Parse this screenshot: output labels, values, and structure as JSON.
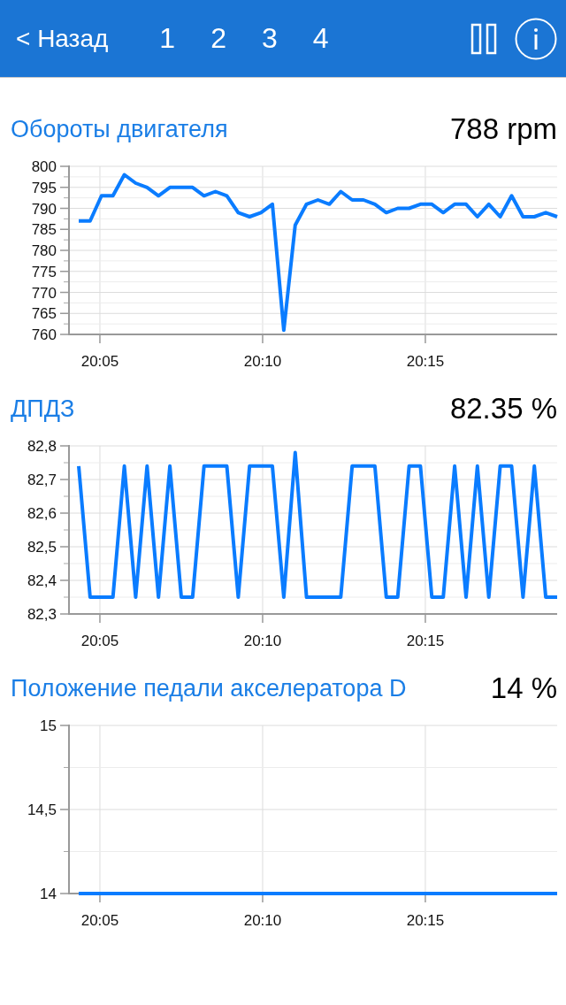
{
  "nav_bar": {
    "back": "< Назад",
    "tabs": [
      {
        "label": "1"
      },
      {
        "label": "2"
      },
      {
        "label": "3"
      },
      {
        "label": "4"
      }
    ]
  },
  "sections": [
    {
      "title": "Обороты двигателя",
      "value": "788 rpm",
      "chart_data": {
        "type": "line",
        "x": [
          1204.35,
          1204.7,
          1205.05,
          1205.4,
          1205.75,
          1206.1,
          1206.45,
          1206.8,
          1207.15,
          1207.5,
          1207.85,
          1208.2,
          1208.55,
          1208.9,
          1209.25,
          1209.6,
          1209.95,
          1210.3,
          1210.65,
          1211.0,
          1211.35,
          1211.7,
          1212.05,
          1212.4,
          1212.75,
          1213.1,
          1213.45,
          1213.8,
          1214.15,
          1214.5,
          1214.85,
          1215.2,
          1215.55,
          1215.9,
          1216.25,
          1216.6,
          1216.95,
          1217.3,
          1217.65,
          1218.0,
          1218.35,
          1218.7,
          1219.05
        ],
        "series": [
          {
            "color": "#0a7cff",
            "values": [
              787,
              787,
              793,
              793,
              798,
              796,
              795,
              793,
              795,
              795,
              795,
              793,
              794,
              793,
              789,
              788,
              789,
              791,
              761,
              786,
              791,
              792,
              791,
              794,
              792,
              792,
              791,
              789,
              790,
              790,
              791,
              791,
              789,
              791,
              791,
              788,
              791,
              788,
              793,
              788,
              788,
              789,
              788
            ]
          }
        ],
        "xlim": [
          1204.05,
          1219.05
        ],
        "ylim": [
          760,
          800
        ],
        "xticks": [
          {
            "value": 1205,
            "label": "20:05"
          },
          {
            "value": 1210,
            "label": "20:10"
          },
          {
            "value": 1215,
            "label": "20:15"
          }
        ],
        "yticks": [
          760,
          765,
          770,
          775,
          780,
          785,
          790,
          795,
          800
        ],
        "ref_lines": [
          {
            "axis": "y",
            "value": 762.5
          },
          {
            "axis": "y",
            "value": 767.5
          },
          {
            "axis": "y",
            "value": 772.5
          },
          {
            "axis": "y",
            "value": 777.5
          },
          {
            "axis": "y",
            "value": 782.5
          },
          {
            "axis": "y",
            "value": 787.5
          },
          {
            "axis": "y",
            "value": 792.5
          },
          {
            "axis": "y",
            "value": 797.5
          }
        ],
        "grid": true
      }
    },
    {
      "title": "ДПДЗ",
      "value": "82.35 %",
      "chart_data": {
        "type": "line",
        "x": [
          1204.35,
          1204.7,
          1205.05,
          1205.4,
          1205.75,
          1206.1,
          1206.45,
          1206.8,
          1207.15,
          1207.5,
          1207.85,
          1208.2,
          1208.55,
          1208.9,
          1209.25,
          1209.6,
          1209.95,
          1210.3,
          1210.65,
          1211.0,
          1211.35,
          1211.7,
          1212.05,
          1212.4,
          1212.75,
          1213.1,
          1213.45,
          1213.8,
          1214.15,
          1214.5,
          1214.85,
          1215.2,
          1215.55,
          1215.9,
          1216.25,
          1216.6,
          1216.95,
          1217.3,
          1217.65,
          1218.0,
          1218.35,
          1218.7,
          1219.05
        ],
        "series": [
          {
            "color": "#0a7cff",
            "values": [
              82.74,
              82.35,
              82.35,
              82.35,
              82.74,
              82.35,
              82.74,
              82.35,
              82.74,
              82.35,
              82.35,
              82.74,
              82.74,
              82.74,
              82.35,
              82.74,
              82.74,
              82.74,
              82.35,
              82.78,
              82.35,
              82.35,
              82.35,
              82.35,
              82.74,
              82.74,
              82.74,
              82.35,
              82.35,
              82.74,
              82.74,
              82.35,
              82.35,
              82.74,
              82.35,
              82.74,
              82.35,
              82.74,
              82.74,
              82.35,
              82.74,
              82.35,
              82.35
            ]
          }
        ],
        "xlim": [
          1204.05,
          1219.05
        ],
        "ylim": [
          82.3,
          82.8
        ],
        "xticks": [
          {
            "value": 1205,
            "label": "20:05"
          },
          {
            "value": 1210,
            "label": "20:10"
          },
          {
            "value": 1215,
            "label": "20:15"
          }
        ],
        "yticks": [
          {
            "value": 82.3,
            "label": "82,3"
          },
          {
            "value": 82.4,
            "label": "82,4"
          },
          {
            "value": 82.5,
            "label": "82,5"
          },
          {
            "value": 82.6,
            "label": "82,6"
          },
          {
            "value": 82.7,
            "label": "82,7"
          },
          {
            "value": 82.8,
            "label": "82,8"
          }
        ],
        "ref_lines": [
          {
            "axis": "y",
            "value": 82.35
          },
          {
            "axis": "y",
            "value": 82.45
          },
          {
            "axis": "y",
            "value": 82.55
          },
          {
            "axis": "y",
            "value": 82.65
          },
          {
            "axis": "y",
            "value": 82.75
          }
        ],
        "grid": true
      }
    },
    {
      "title": "Положение педали акселератора D",
      "value": "14 %",
      "chart_data": {
        "type": "line",
        "x": [
          1204.35,
          1219.05
        ],
        "series": [
          {
            "color": "#0a7cff",
            "values": [
              14,
              14
            ]
          }
        ],
        "xlim": [
          1204.05,
          1219.05
        ],
        "ylim": [
          14,
          15
        ],
        "xticks": [
          {
            "value": 1205,
            "label": "20:05"
          },
          {
            "value": 1210,
            "label": "20:10"
          },
          {
            "value": 1215,
            "label": "20:15"
          }
        ],
        "yticks": [
          14,
          {
            "value": 14.5,
            "label": "14,5"
          },
          15
        ],
        "ref_lines": [
          {
            "axis": "y",
            "value": 14.25
          },
          {
            "axis": "y",
            "value": 14.75
          }
        ],
        "grid": true
      }
    }
  ]
}
